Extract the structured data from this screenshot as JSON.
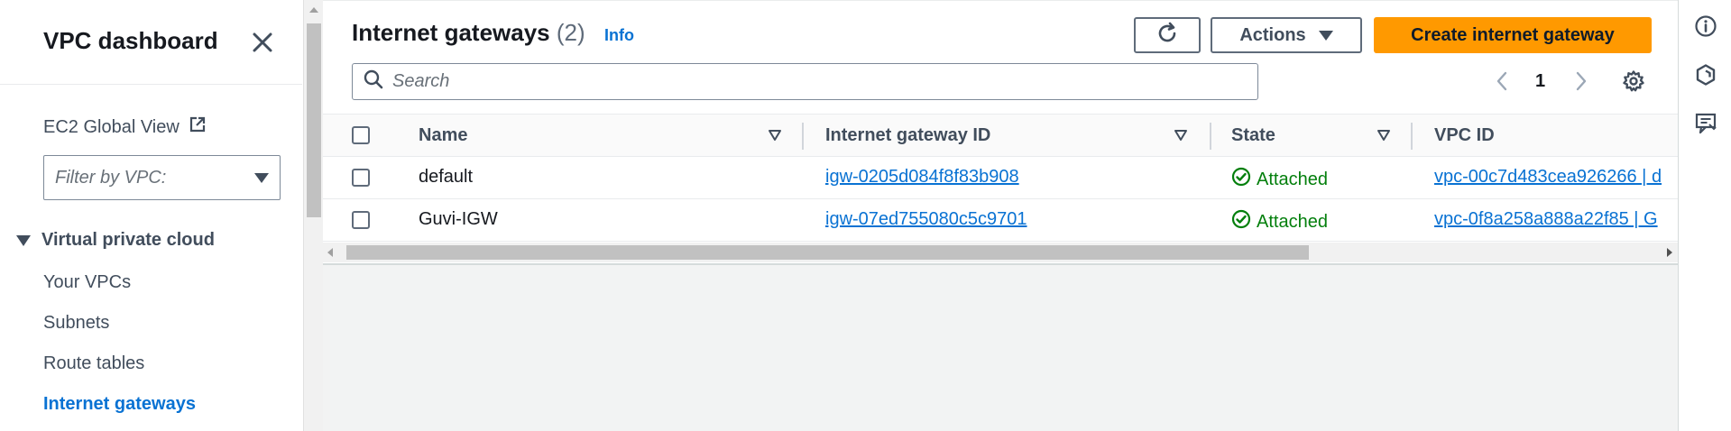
{
  "sidebar": {
    "title": "VPC dashboard",
    "ec2_global_view": "EC2 Global View",
    "filter_placeholder": "Filter by VPC:",
    "section_title": "Virtual private cloud",
    "items": [
      {
        "label": "Your VPCs",
        "active": false
      },
      {
        "label": "Subnets",
        "active": false
      },
      {
        "label": "Route tables",
        "active": false
      },
      {
        "label": "Internet gateways",
        "active": true
      }
    ]
  },
  "header": {
    "title": "Internet gateways",
    "count": "(2)",
    "info": "Info"
  },
  "toolbar": {
    "actions_label": "Actions",
    "create_label": "Create internet gateway"
  },
  "search": {
    "placeholder": "Search",
    "value": ""
  },
  "pagination": {
    "current_page": "1"
  },
  "table": {
    "columns": [
      "Name",
      "Internet gateway ID",
      "State",
      "VPC ID"
    ],
    "rows": [
      {
        "name": "default",
        "gateway_id": "igw-0205d084f8f83b908",
        "state": "Attached",
        "vpc_id": "vpc-00c7d483cea926266 | d"
      },
      {
        "name": "Guvi-IGW",
        "gateway_id": "igw-07ed755080c5c9701",
        "state": "Attached",
        "vpc_id": "vpc-0f8a258a888a22f85 | G"
      }
    ]
  },
  "colors": {
    "primary_button": "#ff9900",
    "link": "#0972d3",
    "success": "#037f0c",
    "active_nav": "#0972d3"
  },
  "icons": {
    "close": "close-icon",
    "external": "external-link-icon",
    "search": "search-icon",
    "refresh": "refresh-icon",
    "settings": "gear-icon",
    "status": "check-circle-icon",
    "rail": [
      "info-icon",
      "hexagon-icon",
      "feedback-icon"
    ]
  }
}
